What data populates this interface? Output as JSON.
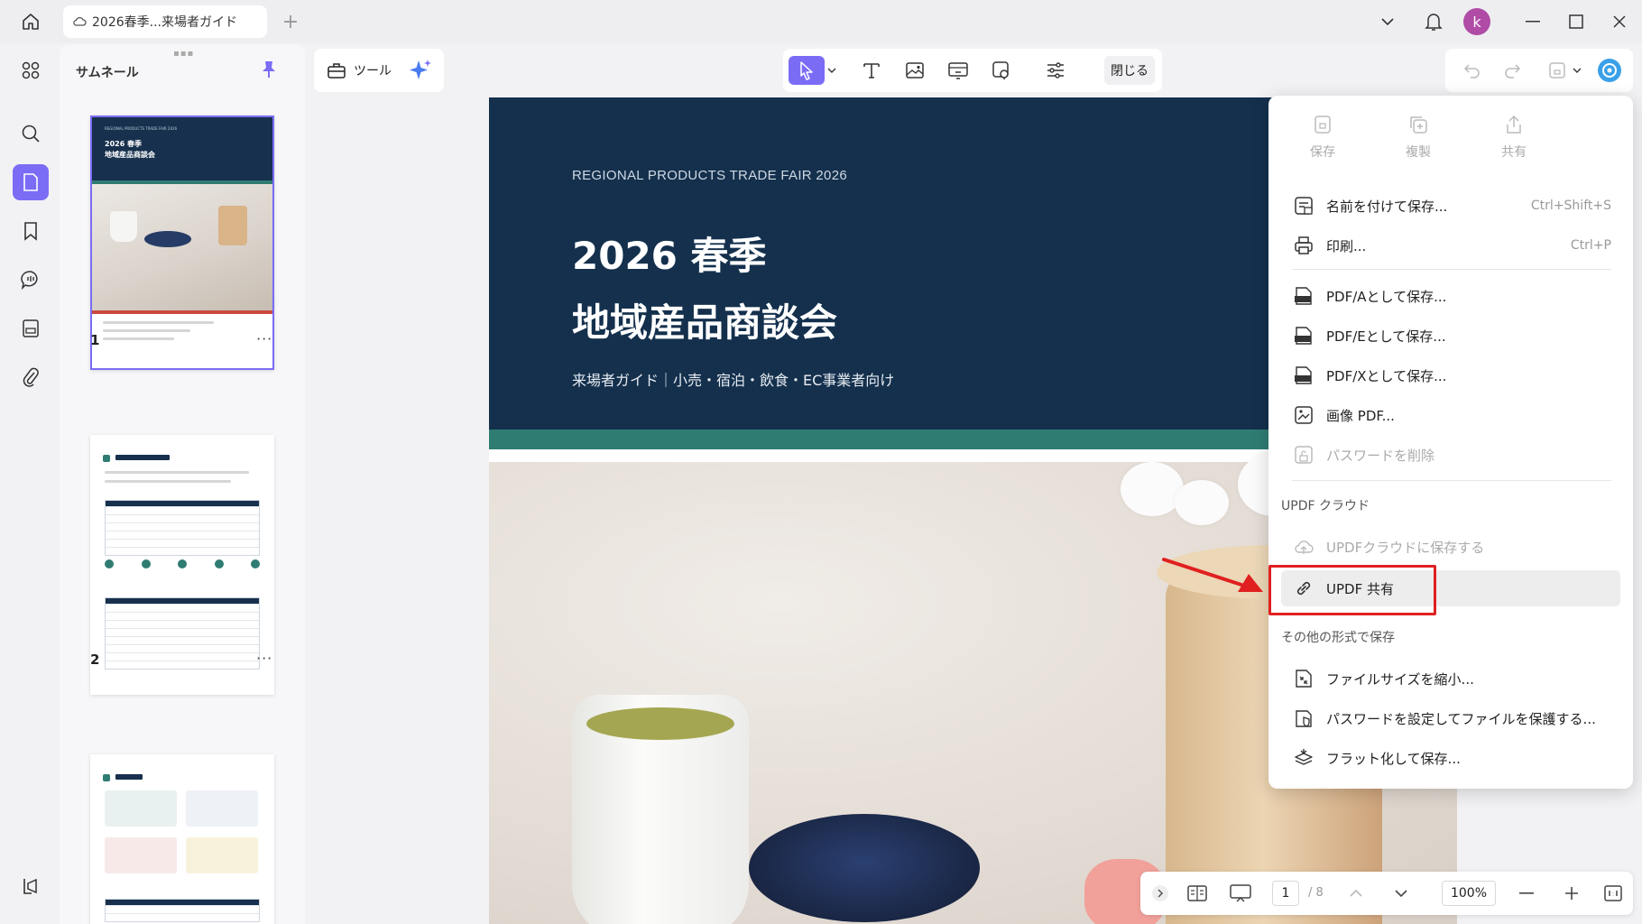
{
  "titlebar": {
    "tab_title": "2026春季...来場者ガイド",
    "avatar_initial": "k"
  },
  "thumbnails": {
    "panel_title": "サムネール",
    "pages": [
      {
        "number": "1",
        "more": "···"
      },
      {
        "number": "2",
        "more": "···"
      }
    ],
    "thumb1_kicker": "REGIONAL PRODUCTS TRADE FAIR 2026",
    "thumb1_title_1": "2026 春季",
    "thumb1_title_2": "地域産品商談会"
  },
  "toolbar": {
    "tools_label": "ツール",
    "close_label": "閉じる"
  },
  "document": {
    "kicker": "REGIONAL PRODUCTS TRADE FAIR 2026",
    "title_line1": "2026 春季",
    "title_line2": "地域産品商談会",
    "subtitle": "来場者ガイド｜小売・宿泊・飲食・EC事業者向け"
  },
  "menu": {
    "quick_actions": [
      {
        "label": "保存",
        "icon": "save-icon"
      },
      {
        "label": "複製",
        "icon": "duplicate-icon"
      },
      {
        "label": "共有",
        "icon": "share-icon"
      }
    ],
    "save_as": {
      "label": "名前を付けて保存...",
      "shortcut": "Ctrl+Shift+S"
    },
    "print": {
      "label": "印刷...",
      "shortcut": "Ctrl+P"
    },
    "pdfa": "PDF/Aとして保存...",
    "pdfe": "PDF/Eとして保存...",
    "pdfx": "PDF/Xとして保存...",
    "image_pdf": "画像 PDF...",
    "remove_password": "パスワードを削除",
    "cloud_section": "UPDF クラウド",
    "save_to_cloud": "UPDFクラウドに保存する",
    "updf_share": "UPDF 共有",
    "other_section": "その他の形式で保存",
    "reduce_size": "ファイルサイズを縮小...",
    "protect_password": "パスワードを設定してファイルを保護する...",
    "flatten_save": "フラット化して保存..."
  },
  "bottombar": {
    "current_page": "1",
    "total_pages": "/ 8",
    "zoom": "100%"
  }
}
